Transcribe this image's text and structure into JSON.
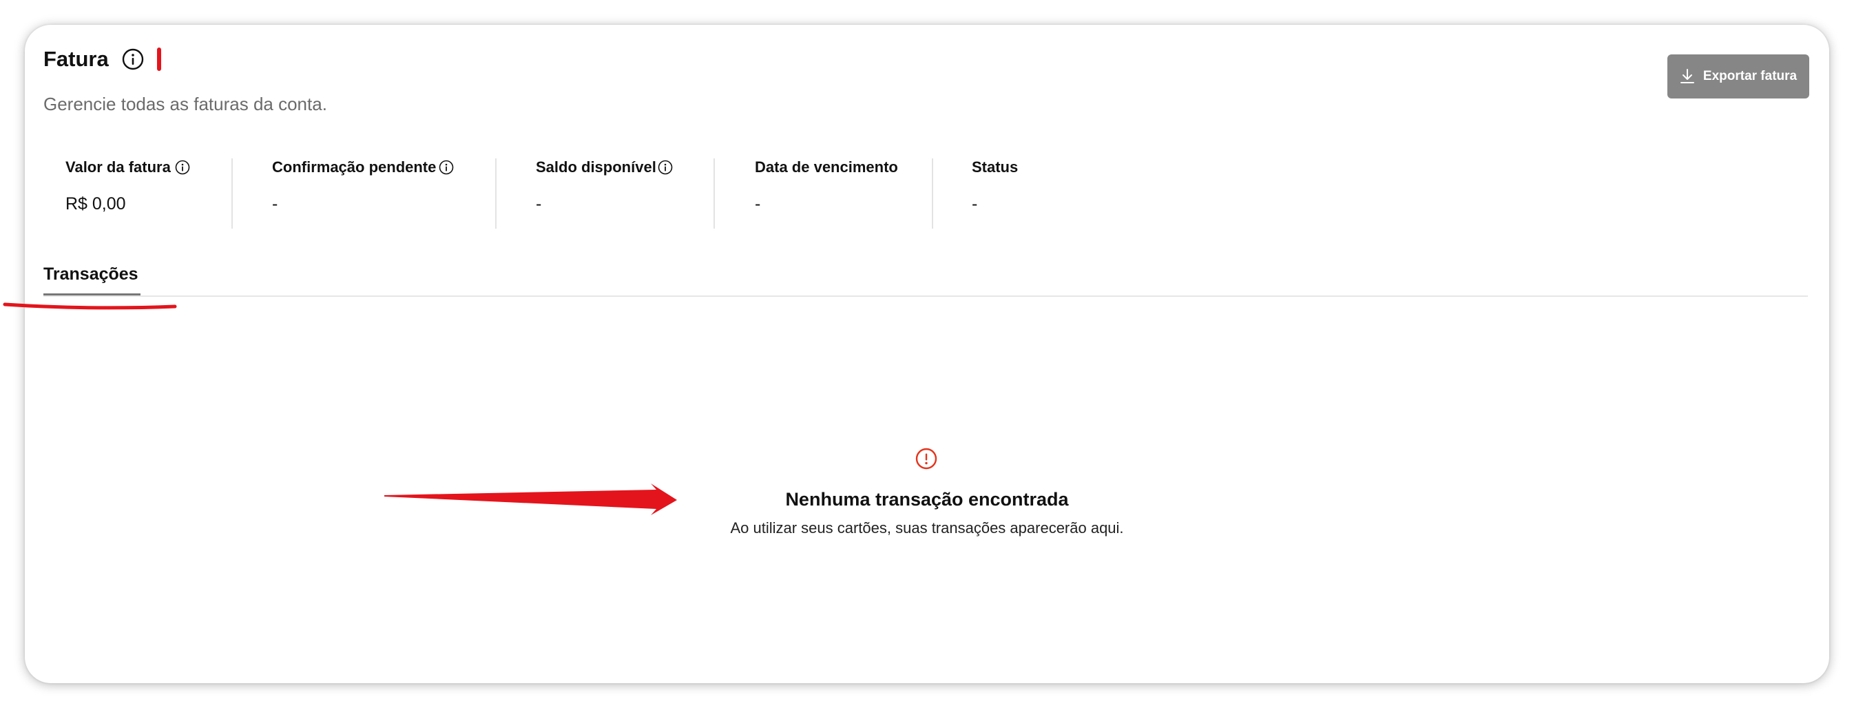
{
  "header": {
    "title": "Fatura",
    "subtitle": "Gerencie todas as faturas da conta.",
    "export_label": "Exportar fatura"
  },
  "stats": [
    {
      "label": "Valor da fatura",
      "value": "R$ 0,00",
      "has_info": true
    },
    {
      "label": "Confirmação pendente",
      "value": "-",
      "has_info": true
    },
    {
      "label": "Saldo disponível",
      "value": "-",
      "has_info": true
    },
    {
      "label": "Data de vencimento",
      "value": "-",
      "has_info": false
    },
    {
      "label": "Status",
      "value": "-",
      "has_info": false
    }
  ],
  "tabs": [
    {
      "label": "Transações",
      "active": true
    }
  ],
  "empty_state": {
    "title": "Nenhuma transação encontrada",
    "description": "Ao utilizar seus cartões, suas transações aparecerão aqui."
  },
  "icons": {
    "title_info": "info-circle-icon",
    "stat_info": "info-circle-icon",
    "export": "download-icon",
    "empty": "alert-circle-icon"
  },
  "colors": {
    "primary_text": "#111111",
    "muted_text": "#6b6b6b",
    "button_bg": "#868686",
    "empty_icon": "#e4341c",
    "annotation_red": "#e4141c"
  }
}
